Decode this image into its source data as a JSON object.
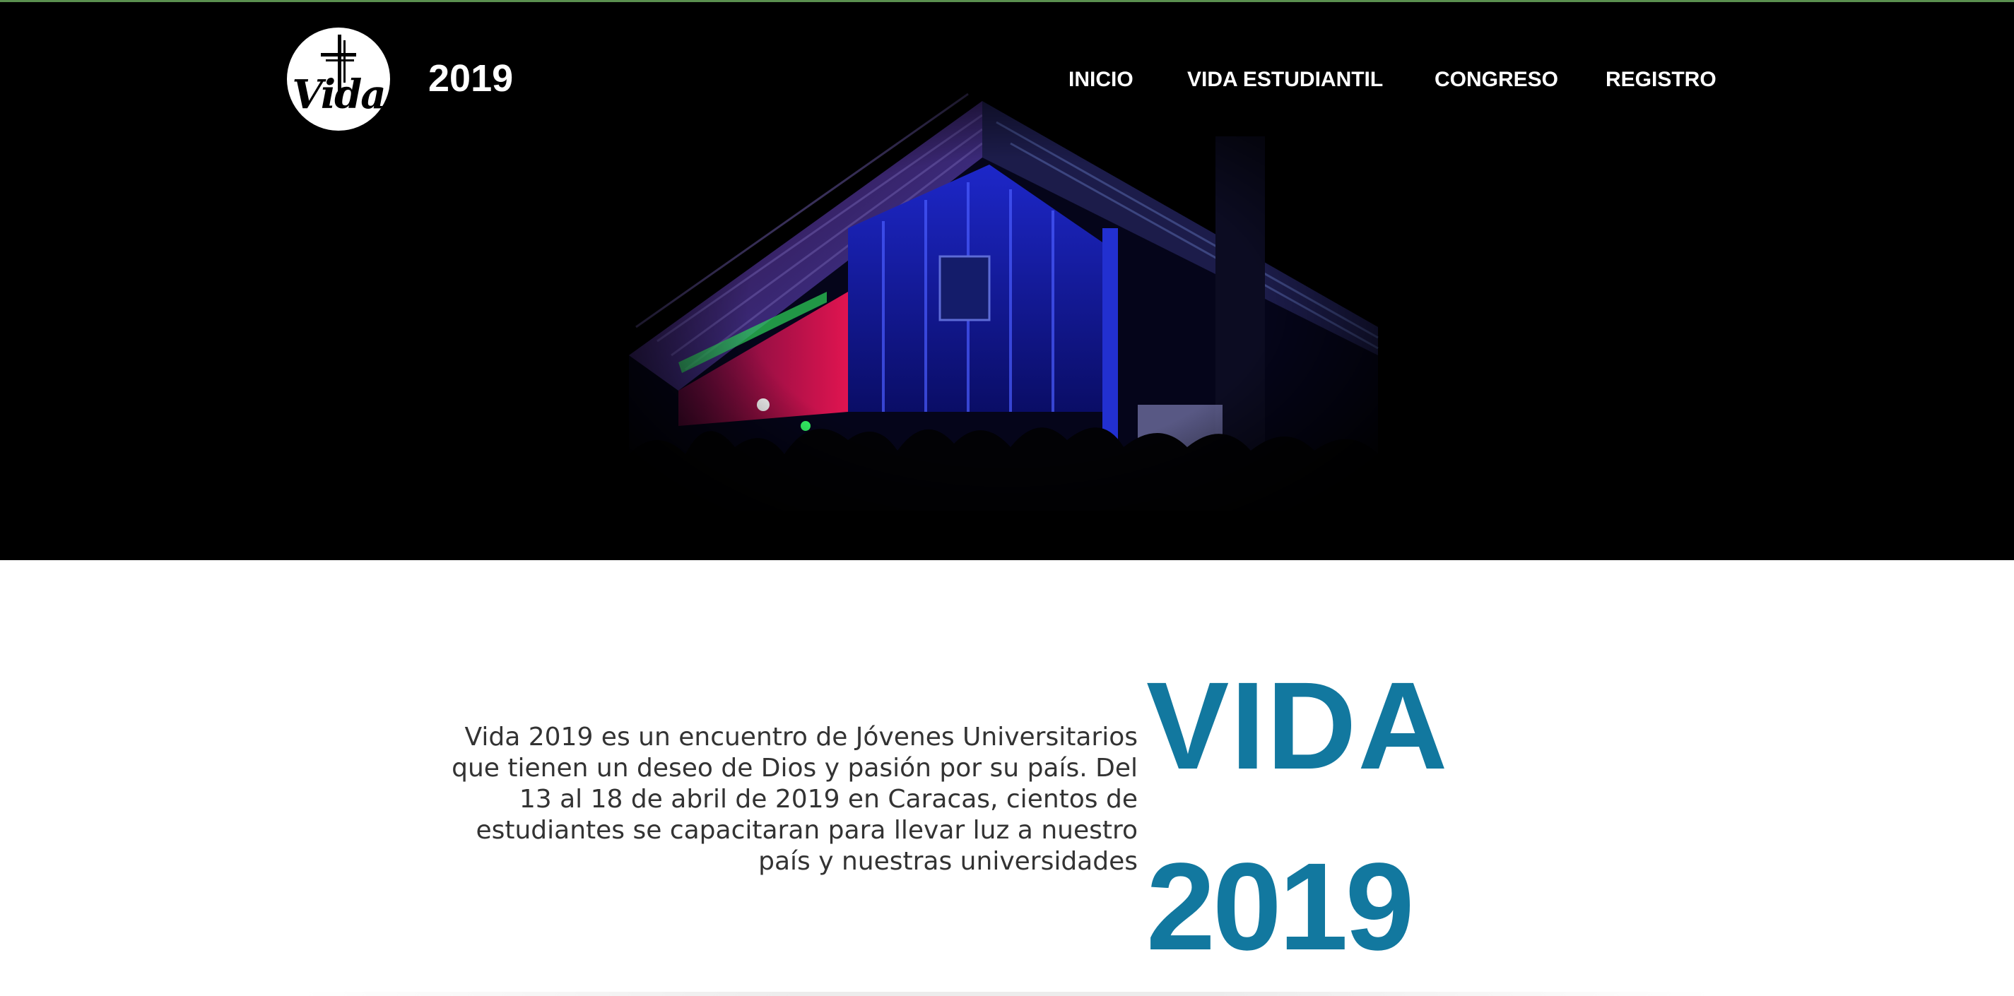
{
  "header": {
    "logo_text": "Vida",
    "year": "2019",
    "nav": [
      {
        "label": "INICIO"
      },
      {
        "label": "VIDA ESTUDIANTIL"
      },
      {
        "label": "CONGRESO"
      },
      {
        "label": "REGISTRO"
      }
    ]
  },
  "hero": {
    "image": "concert-stage-photo"
  },
  "intro": {
    "text": "Vida 2019 es un encuentro de Jóvenes Universitarios que tienen un deseo de Dios y pasión por su país. Del 13 al 18 de abril de 2019 en Caracas, cientos de estudiantes se capacitaran para llevar luz a nuestro país y nuestras universidades",
    "title_line1": "VIDA",
    "title_line2": "2019"
  },
  "colors": {
    "title": "#12789f",
    "body_text": "#333333",
    "hero_bg": "#000000",
    "nav_text": "#ffffff"
  }
}
